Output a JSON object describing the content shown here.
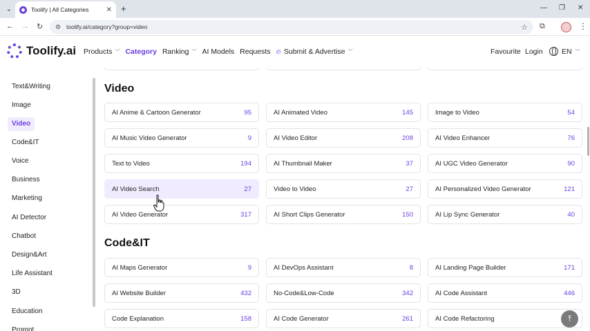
{
  "browser": {
    "tab_title": "Toolify | All Categories",
    "url": "toolify.ai/category?group=video"
  },
  "header": {
    "logo": "Toolify.ai",
    "nav": [
      {
        "label": "Products",
        "chevron": true,
        "active": false
      },
      {
        "label": "Category",
        "chevron": false,
        "active": true
      },
      {
        "label": "Ranking",
        "chevron": true,
        "active": false
      },
      {
        "label": "AI Models",
        "chevron": false,
        "active": false
      },
      {
        "label": "Requests",
        "chevron": false,
        "active": false
      },
      {
        "label": "Submit & Advertise",
        "chevron": true,
        "active": false,
        "icon": "flame-icon"
      }
    ],
    "favourite": "Favourite",
    "login": "Login",
    "language": "EN"
  },
  "sidebar": {
    "active": "Video",
    "items": [
      "Text&Writing",
      "Image",
      "Video",
      "Code&IT",
      "Voice",
      "Business",
      "Marketing",
      "AI Detector",
      "Chatbot",
      "Design&Art",
      "Life Assistant",
      "3D",
      "Education",
      "Prompt"
    ]
  },
  "sections": [
    {
      "title": "Video",
      "cards": [
        {
          "label": "AI Anime & Cartoon Generator",
          "count": "95"
        },
        {
          "label": "AI Animated Video",
          "count": "145"
        },
        {
          "label": "Image to Video",
          "count": "54"
        },
        {
          "label": "AI Music Video Generator",
          "count": "9"
        },
        {
          "label": "AI Video Editor",
          "count": "208"
        },
        {
          "label": "AI Video Enhancer",
          "count": "76"
        },
        {
          "label": "Text to Video",
          "count": "194"
        },
        {
          "label": "AI Thumbnail Maker",
          "count": "37"
        },
        {
          "label": "AI UGC Video Generator",
          "count": "90"
        },
        {
          "label": "AI Video Search",
          "count": "27",
          "hover": true
        },
        {
          "label": "Video to Video",
          "count": "27"
        },
        {
          "label": "AI Personalized Video Generator",
          "count": "121"
        },
        {
          "label": "AI Video Generator",
          "count": "317"
        },
        {
          "label": "AI Short Clips Generator",
          "count": "150"
        },
        {
          "label": "AI Lip Sync Generator",
          "count": "40"
        }
      ]
    },
    {
      "title": "Code&IT",
      "cards": [
        {
          "label": "AI Maps Generator",
          "count": "9"
        },
        {
          "label": "AI DevOps Assistant",
          "count": "8"
        },
        {
          "label": "AI Landing Page Builder",
          "count": "171"
        },
        {
          "label": "AI Website Builder",
          "count": "432"
        },
        {
          "label": "No-Code&Low-Code",
          "count": "342"
        },
        {
          "label": "AI Code Assistant",
          "count": "446"
        },
        {
          "label": "Code Explanation",
          "count": "158"
        },
        {
          "label": "AI Code Generator",
          "count": "261"
        },
        {
          "label": "AI Code Refactoring",
          "count": ""
        }
      ]
    }
  ],
  "colors": {
    "accent": "#6b3fe0",
    "hover_bg": "#f1ebff"
  }
}
